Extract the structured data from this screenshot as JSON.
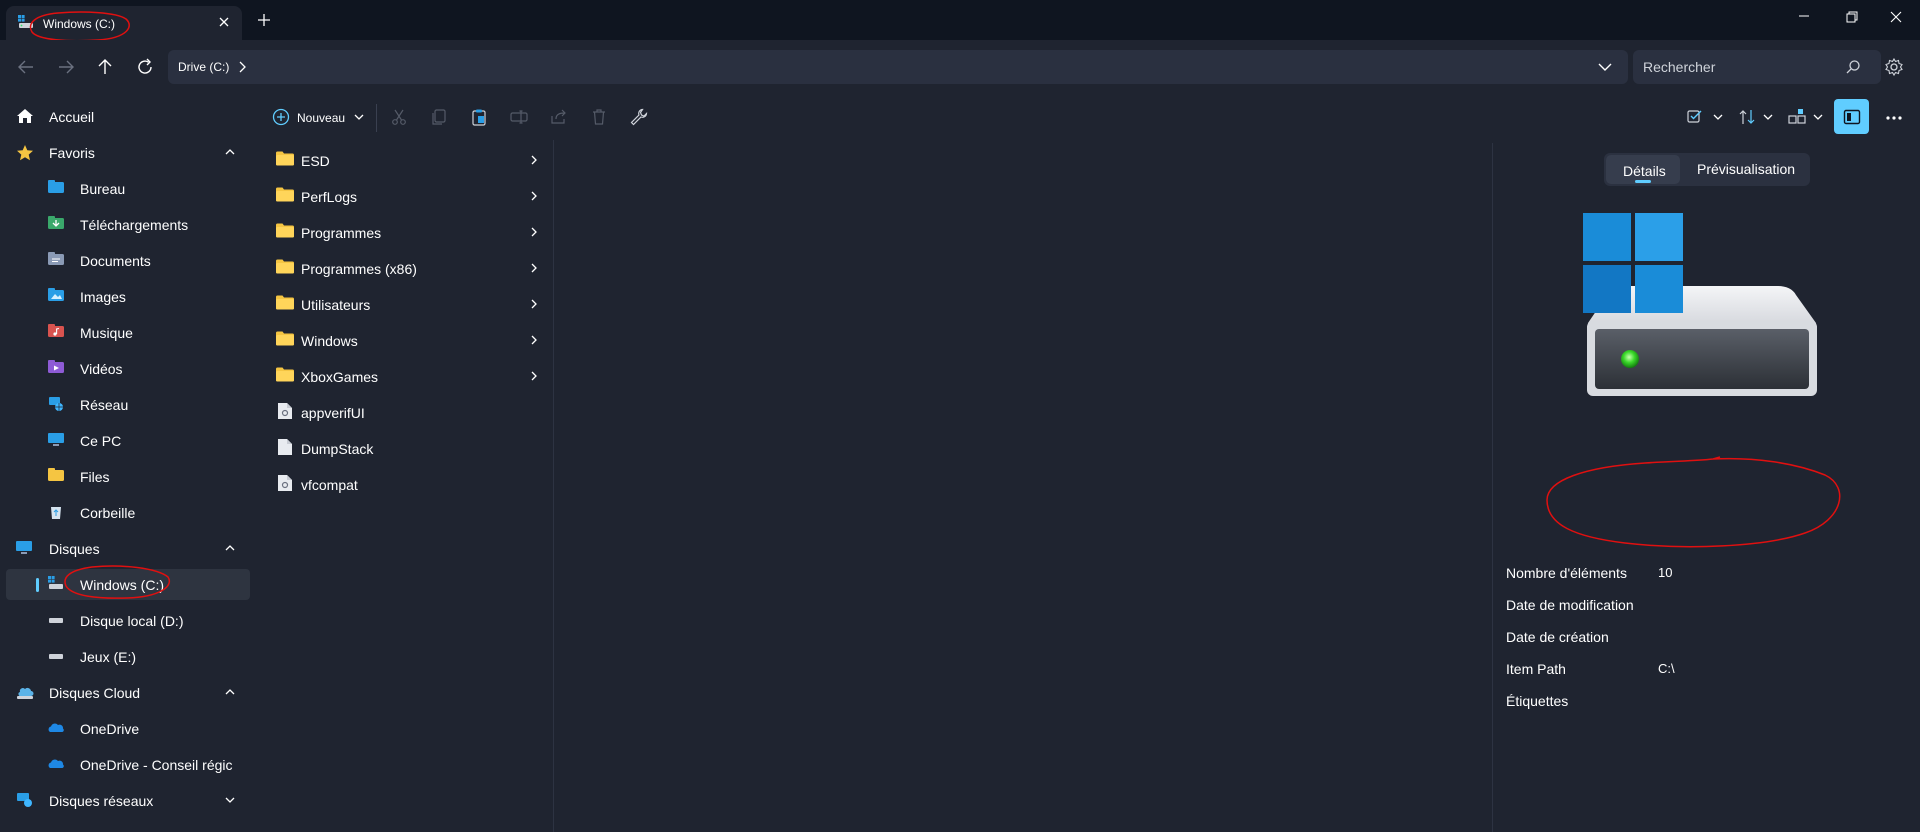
{
  "window": {
    "tab_title": "Windows (C:)",
    "new_tab_symbol": "+"
  },
  "address": {
    "breadcrumb": "Drive (C:)",
    "search_placeholder": "Rechercher"
  },
  "toolbar": {
    "new_label": "Nouveau"
  },
  "sidebar": {
    "home": "Accueil",
    "favorites": {
      "label": "Favoris",
      "items": [
        "Bureau",
        "Téléchargements",
        "Documents",
        "Images",
        "Musique",
        "Vidéos",
        "Réseau",
        "Ce PC",
        "Files",
        "Corbeille"
      ]
    },
    "drives": {
      "label": "Disques",
      "items": [
        "Windows (C:)",
        "Disque local (D:)",
        "Jeux (E:)"
      ]
    },
    "cloud": {
      "label": "Disques Cloud",
      "items": [
        "OneDrive",
        "OneDrive - Conseil régic"
      ]
    },
    "network": {
      "label": "Disques réseaux"
    }
  },
  "files": [
    {
      "name": "ESD",
      "type": "folder"
    },
    {
      "name": "PerfLogs",
      "type": "folder"
    },
    {
      "name": "Programmes",
      "type": "folder"
    },
    {
      "name": "Programmes (x86)",
      "type": "folder"
    },
    {
      "name": "Utilisateurs",
      "type": "folder"
    },
    {
      "name": "Windows",
      "type": "folder"
    },
    {
      "name": "XboxGames",
      "type": "folder"
    },
    {
      "name": "appverifUI",
      "type": "file"
    },
    {
      "name": "DumpStack",
      "type": "file"
    },
    {
      "name": "vfcompat",
      "type": "file"
    }
  ],
  "details": {
    "tab_details": "Détails",
    "tab_preview": "Prévisualisation",
    "properties": [
      {
        "name": "Nombre d'éléments",
        "value": "10"
      },
      {
        "name": "Date de modification",
        "value": ""
      },
      {
        "name": "Date de création",
        "value": ""
      },
      {
        "name": "Item Path",
        "value": "C:\\"
      },
      {
        "name": "Étiquettes",
        "value": ""
      }
    ]
  },
  "colors": {
    "accent": "#60cdff",
    "annotation": "#e01010",
    "folder": "#f5c542"
  },
  "icons": {
    "folder": "folder-icon",
    "file": "file-icon",
    "drive": "drive-icon",
    "cloud": "cloud-icon"
  }
}
